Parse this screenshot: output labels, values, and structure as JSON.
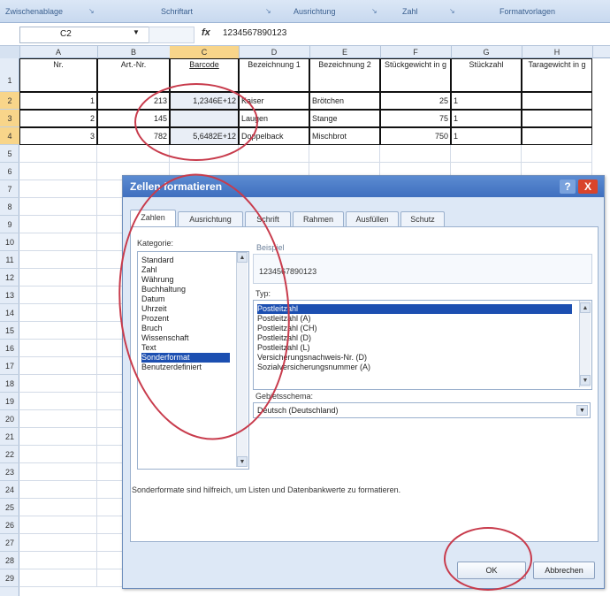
{
  "ribbon": {
    "groups": [
      "Zwischenablage",
      "Schriftart",
      "Ausrichtung",
      "Zahl",
      "Formatvorlagen"
    ]
  },
  "formula_bar": {
    "name_box": "C2",
    "fx_label": "fx",
    "value": "1234567890123"
  },
  "sheet": {
    "columns": [
      "A",
      "B",
      "C",
      "D",
      "E",
      "F",
      "G",
      "H"
    ],
    "selected_column": "C",
    "rows": [
      "1",
      "2",
      "3",
      "4",
      "5",
      "6",
      "7",
      "8",
      "9",
      "10",
      "11",
      "12",
      "13",
      "14",
      "15",
      "16",
      "17",
      "18",
      "19",
      "20",
      "21",
      "22",
      "23",
      "24",
      "25",
      "26",
      "27",
      "28",
      "29"
    ],
    "selected_rows": [
      "2",
      "3",
      "4"
    ],
    "header_row": [
      "Nr.",
      "Art.-Nr.",
      "Barcode",
      "Bezeichnung 1",
      "Bezeichnung 2",
      "Stückgewicht in g",
      "Stückzahl",
      "Taragewicht in g"
    ],
    "data_rows": [
      [
        "1",
        "213",
        "1,2346E+12",
        "Kaiser",
        "Brötchen",
        "25",
        "1",
        ""
      ],
      [
        "2",
        "145",
        "",
        "Laugen",
        "Stange",
        "75",
        "1",
        ""
      ],
      [
        "3",
        "782",
        "5,6482E+12",
        "Doppelback",
        "Mischbrot",
        "750",
        "1",
        ""
      ]
    ]
  },
  "dialog": {
    "title": "Zellen formatieren",
    "help": "?",
    "close": "X",
    "tabs": [
      "Zahlen",
      "Ausrichtung",
      "Schrift",
      "Rahmen",
      "Ausfüllen",
      "Schutz"
    ],
    "active_tab": "Zahlen",
    "category_label": "Kategorie:",
    "categories": [
      "Standard",
      "Zahl",
      "Währung",
      "Buchhaltung",
      "Datum",
      "Uhrzeit",
      "Prozent",
      "Bruch",
      "Wissenschaft",
      "Text",
      "Sonderformat",
      "Benutzerdefiniert"
    ],
    "selected_category": "Sonderformat",
    "sample_label": "Beispiel",
    "sample_value": "1234567890123",
    "type_label": "Typ:",
    "types": [
      "Postleitzahl",
      "Postleitzahl (A)",
      "Postleitzahl (CH)",
      "Postleitzahl (D)",
      "Postleitzahl (L)",
      "Versicherungsnachweis-Nr. (D)",
      "Sozialversicherungsnummer (A)"
    ],
    "selected_type": "Postleitzahl",
    "locale_label": "Gebietsschema:",
    "locale_value": "Deutsch (Deutschland)",
    "description": "Sonderformate sind hilfreich, um Listen und Datenbankwerte zu formatieren.",
    "ok": "OK",
    "cancel": "Abbrechen"
  },
  "colors": {
    "accent": "#3f6fbf",
    "selection": "#1c4fb1",
    "annotation": "#c83b4c",
    "header_selected": "#f8d58a"
  }
}
